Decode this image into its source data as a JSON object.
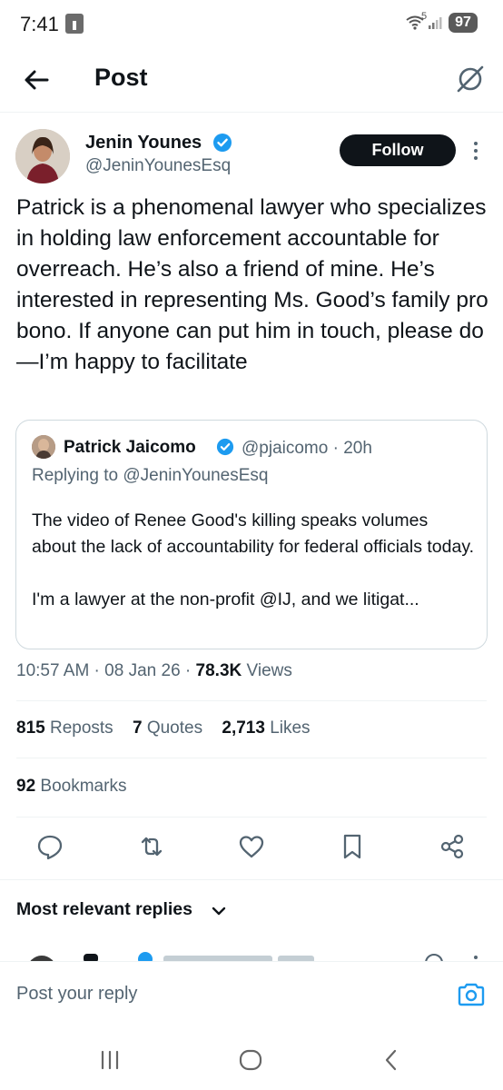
{
  "status_bar": {
    "time": "7:41",
    "network": "5",
    "battery": "97"
  },
  "header": {
    "title": "Post",
    "back_icon": "arrow-left-icon",
    "grok_icon": "grok-icon"
  },
  "post": {
    "author_name": "Jenin Younes",
    "author_handle": "@JeninYounesEsq",
    "follow_label": "Follow",
    "text": "Patrick is a phenomenal lawyer who specializes in holding law enforcement accountable for overreach. He’s also a friend of mine. He’s interested in representing Ms. Good’s family pro bono. If anyone can put him in touch, please do—I’m happy to facilitate",
    "time": "10:57 AM",
    "date": "08 Jan 26",
    "views_count": "78.3K",
    "views_label": "Views"
  },
  "quote": {
    "author_name": "Patrick Jaicomo",
    "author_handle": "@pjaicomo",
    "age": "20h",
    "replying_to": "Replying to @JeninYounesEsq",
    "text": "The video of Renee Good's killing speaks volumes about the lack of accountability for federal officials today.\n\nI'm a lawyer at the non-profit @IJ, and we litigat..."
  },
  "stats": {
    "reposts_count": "815",
    "reposts_label": "Reposts",
    "quotes_count": "7",
    "quotes_label": "Quotes",
    "likes_count": "2,713",
    "likes_label": "Likes",
    "bookmarks_count": "92",
    "bookmarks_label": "Bookmarks"
  },
  "replies": {
    "sort_label": "Most relevant replies"
  },
  "reply_bar": {
    "placeholder": "Post your reply"
  },
  "colors": {
    "verified": "#1d9bf0",
    "accent": "#1d9bf0",
    "text": "#0f1419",
    "muted": "#536471"
  }
}
